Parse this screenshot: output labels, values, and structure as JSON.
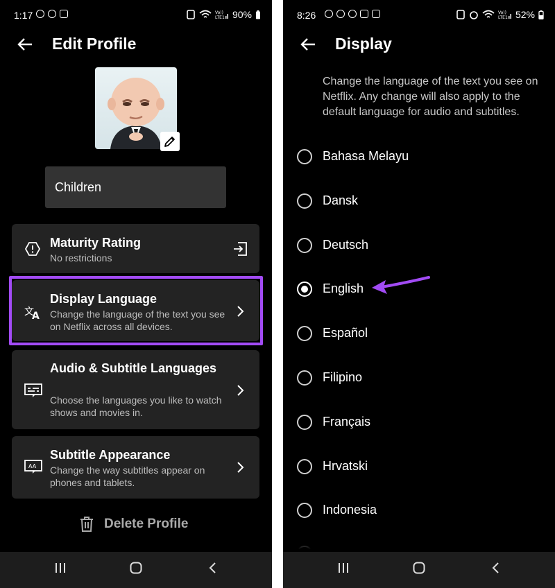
{
  "left": {
    "status": {
      "time": "1:17",
      "battery": "90%"
    },
    "header": {
      "title": "Edit Profile"
    },
    "profile_name": "Children",
    "cards": [
      {
        "title": "Maturity Rating",
        "desc": "No restrictions"
      },
      {
        "title": "Display Language",
        "desc": "Change the language of the text you see on Netflix across all devices."
      },
      {
        "title": "Audio & Subtitle Languages",
        "desc": "Choose the languages you like to watch shows and movies in."
      },
      {
        "title": "Subtitle Appearance",
        "desc": "Change the way subtitles appear on phones and tablets."
      }
    ],
    "delete_label": "Delete Profile"
  },
  "right": {
    "status": {
      "time": "8:26",
      "battery": "52%"
    },
    "header": {
      "title": "Display"
    },
    "intro": "Change the language of the text you see on Netflix. Any change will also apply to the default language for audio and subtitles.",
    "languages": [
      {
        "label": "Bahasa Melayu",
        "selected": false
      },
      {
        "label": "Dansk",
        "selected": false
      },
      {
        "label": "Deutsch",
        "selected": false
      },
      {
        "label": "English",
        "selected": true
      },
      {
        "label": "Español",
        "selected": false
      },
      {
        "label": "Filipino",
        "selected": false
      },
      {
        "label": "Français",
        "selected": false
      },
      {
        "label": "Hrvatski",
        "selected": false
      },
      {
        "label": "Indonesia",
        "selected": false
      }
    ]
  },
  "colors": {
    "highlight": "#a24bf5",
    "card": "#232323",
    "field": "#333333"
  }
}
